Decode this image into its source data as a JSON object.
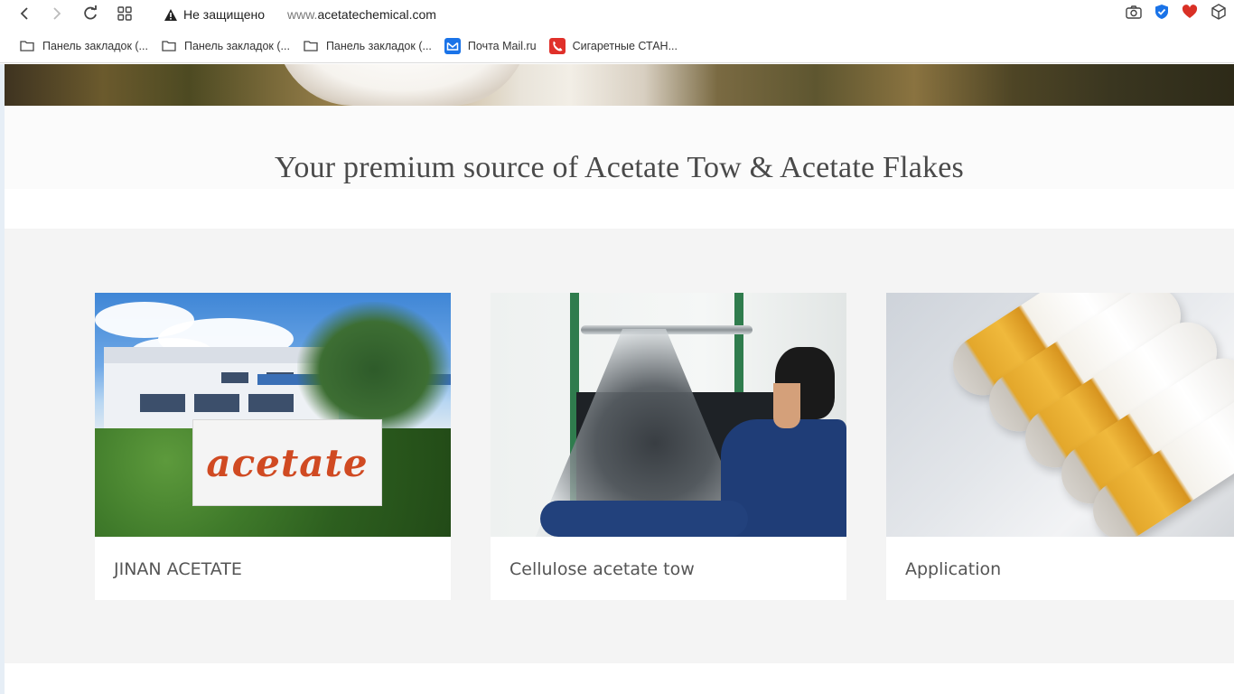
{
  "browser": {
    "security_label": "Не защищено",
    "url_prefix": "www.",
    "url_domain": "acetatechemical.com"
  },
  "bookmarks": [
    {
      "label": "Панель закладок (...",
      "icon": "folder-icon"
    },
    {
      "label": "Панель закладок (...",
      "icon": "folder-icon"
    },
    {
      "label": "Панель закладок (...",
      "icon": "folder-icon"
    },
    {
      "label": "Почта Mail.ru",
      "icon": "mail-ru-icon"
    },
    {
      "label": "Сигаретные СТАН...",
      "icon": "phone-icon"
    }
  ],
  "page": {
    "tagline": "Your premium source of Acetate Tow & Acetate Flakes",
    "cards": [
      {
        "title": "JINAN ACETATE",
        "sign_text": "acetate"
      },
      {
        "title": "Cellulose acetate tow"
      },
      {
        "title": "Application"
      }
    ]
  },
  "colors": {
    "accent_blue": "#1a73e8",
    "heart_red": "#d93025",
    "sign_orange": "#d04a22"
  }
}
